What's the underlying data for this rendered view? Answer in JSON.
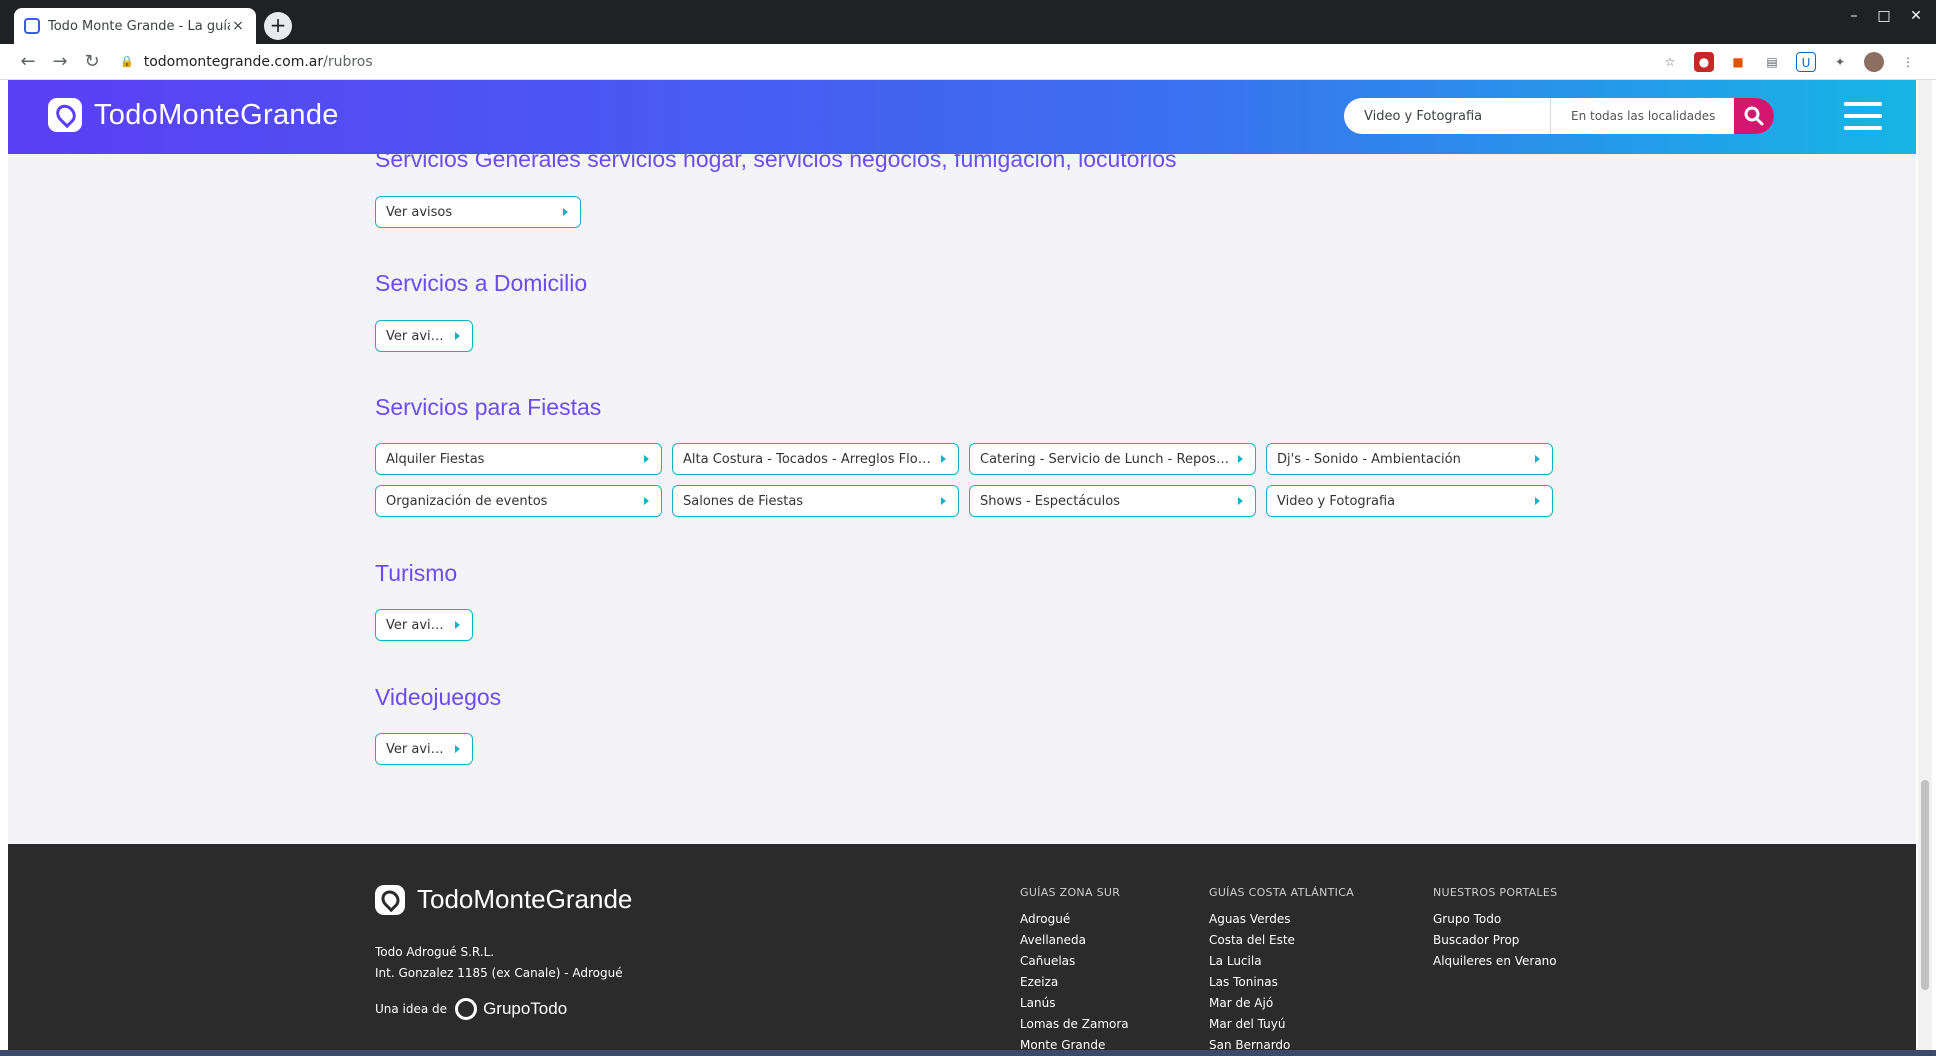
{
  "browser": {
    "tab_title": "Todo Monte Grande - La guía de",
    "url_host": "todomontegrande.com.ar",
    "url_path": "/rubros",
    "new_tab": "+",
    "tab_close": "×"
  },
  "header": {
    "brand": "TodoMonteGrande",
    "search_value": "Video y Fotografia",
    "location_value": "En todas las localidades"
  },
  "sections": [
    {
      "title": "Servicios Generales servicios hogar, servicios negocios, fumigación, locutorios",
      "buttons": [
        "Ver avisos"
      ]
    },
    {
      "title": "Servicios a Domicilio",
      "buttons": [
        "Ver avisos"
      ]
    },
    {
      "title": "Servicios para Fiestas",
      "buttons": [
        "Alquiler Fiestas",
        "Alta Costura - Tocados - Arreglos Florales",
        "Catering - Servicio de Lunch - Repostería",
        "Dj's - Sonido - Ambientación",
        "Organización de eventos",
        "Salones de Fiestas",
        "Shows - Espectáculos",
        "Video y Fotografia"
      ]
    },
    {
      "title": "Turismo",
      "buttons": [
        "Ver avisos"
      ]
    },
    {
      "title": "Videojuegos",
      "buttons": [
        "Ver avisos"
      ]
    }
  ],
  "footer": {
    "brand": "TodoMonteGrande",
    "company": "Todo Adrogué S.R.L.",
    "address": "Int. Gonzalez 1185 (ex Canale) - Adrogué",
    "idea_label": "Una idea de",
    "idea_brand": "GrupoTodo",
    "columns": [
      {
        "heading": "GUÍAS ZONA SUR",
        "links": [
          "Adrogué",
          "Avellaneda",
          "Cañuelas",
          "Ezeiza",
          "Lanús",
          "Lomas de Zamora",
          "Monte Grande"
        ]
      },
      {
        "heading": "GUÍAS COSTA ATLÁNTICA",
        "links": [
          "Aguas Verdes",
          "Costa del Este",
          "La Lucila",
          "Las Toninas",
          "Mar de Ajó",
          "Mar del Tuyú",
          "San Bernardo"
        ]
      },
      {
        "heading": "NUESTROS PORTALES",
        "links": [
          "Grupo Todo",
          "Buscador Prop",
          "Alquileres en Verano"
        ]
      }
    ]
  },
  "colors": {
    "header_gradient_start": "#5b3ff5",
    "header_gradient_end": "#16b6e6",
    "section_title": "#6a4cf0",
    "button_border": "#1ab0c6",
    "search_button": "#d3176f",
    "footer_bg": "#2b2b2b"
  }
}
